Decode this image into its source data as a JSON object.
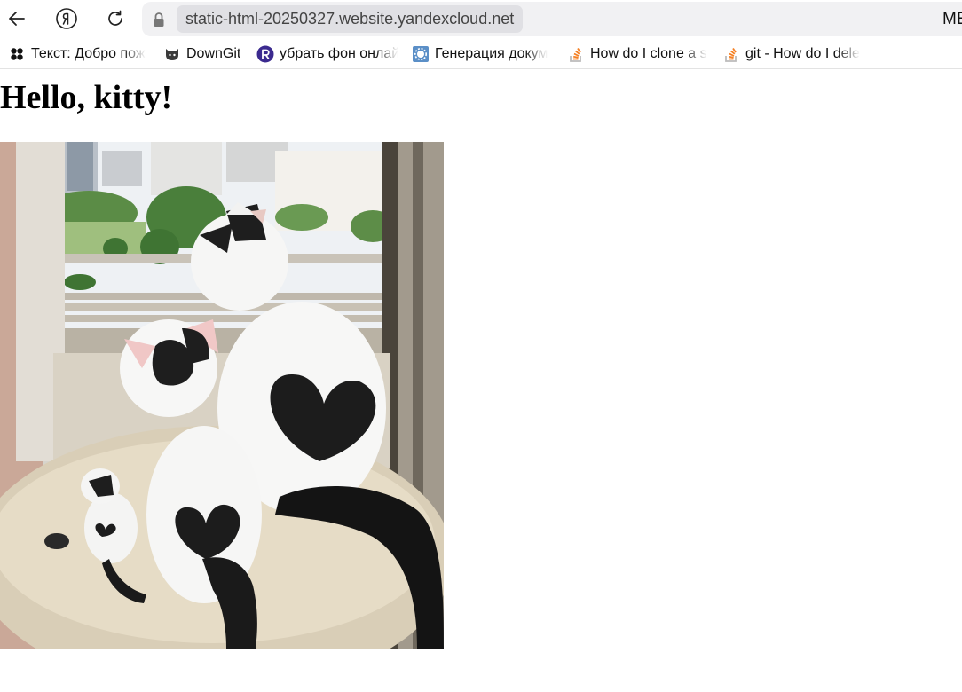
{
  "browser": {
    "url": "static-html-20250327.website.yandexcloud.net",
    "tab_title": "MEAOW",
    "nav": {
      "back_icon": "arrow-left-icon",
      "yandex_icon": "yandex-logo-icon",
      "reload_icon": "reload-icon",
      "lock_icon": "lock-icon"
    }
  },
  "bookmarks": [
    {
      "label": "Текст: Добро пож",
      "icon": "clover-icon"
    },
    {
      "label": "DownGit",
      "icon": "github-icon"
    },
    {
      "label": "убрать фон онлай",
      "icon": "r-logo-icon"
    },
    {
      "label": "Генерация докум",
      "icon": "image-gear-icon"
    },
    {
      "label": "How do I clone a s",
      "icon": "stackoverflow-icon"
    },
    {
      "label": "git - How do I dele",
      "icon": "stackoverflow-icon"
    }
  ],
  "page": {
    "heading": "Hello, kitty!",
    "image_subject": "cats-photo"
  },
  "colors": {
    "omnibox_bg": "#f1f1f3",
    "url_pill_bg": "#e0e0e4",
    "stackoverflow_orange": "#f48024",
    "r_logo_bg": "#3b2a8f"
  }
}
